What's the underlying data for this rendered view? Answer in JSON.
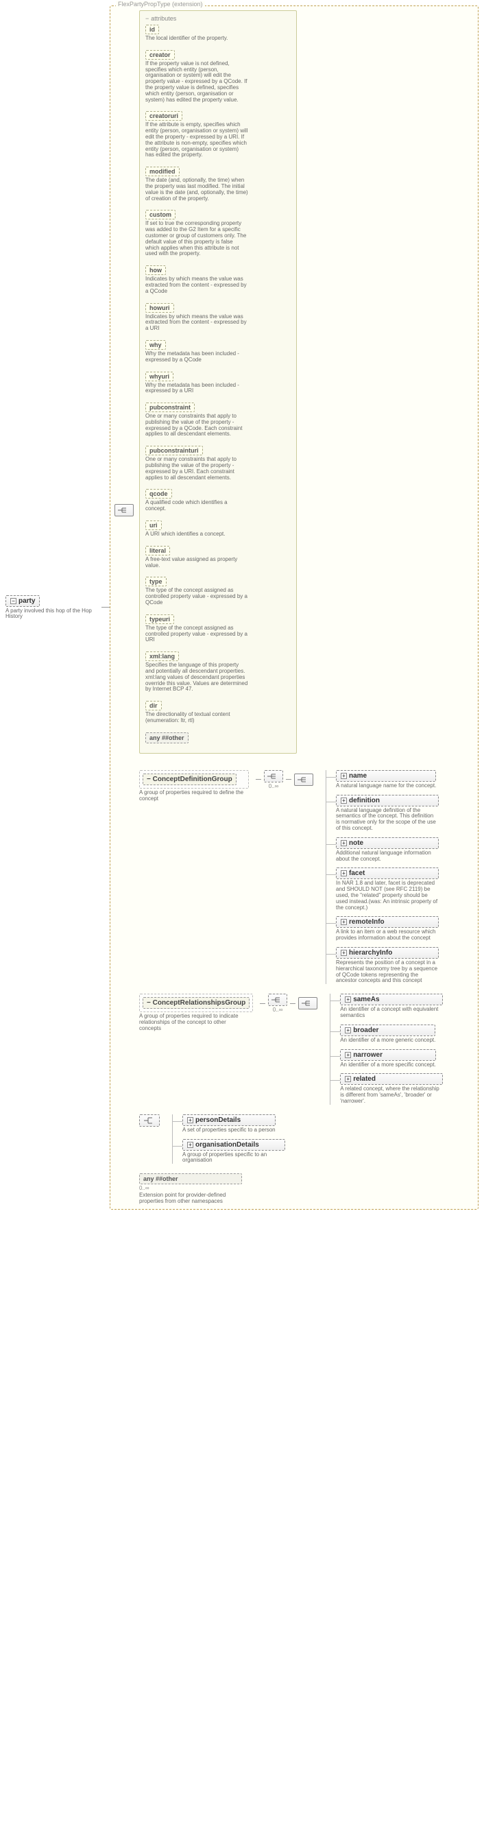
{
  "root": {
    "name": "party",
    "desc": "A party involved this hop of the Hop History"
  },
  "extension": {
    "label": "FlexPartyPropType (extension)"
  },
  "attrs_label": "attributes",
  "attributes": [
    {
      "name": "id",
      "desc": "The local identifier of the property."
    },
    {
      "name": "creator",
      "desc": "If the property value is not defined, specifies which entity (person, organisation or system) will edit the property value - expressed by a QCode. If the property value is defined, specifies which entity (person, organisation or system) has edited the property value."
    },
    {
      "name": "creatoruri",
      "desc": "If the attribute is empty, specifies which entity (person, organisation or system) will edit the property - expressed by a URI. If the attribute is non-empty, specifies which entity (person, organisation or system) has edited the property."
    },
    {
      "name": "modified",
      "desc": "The date (and, optionally, the time) when the property was last modified. The initial value is the date (and, optionally, the time) of creation of the property."
    },
    {
      "name": "custom",
      "desc": "If set to true the corresponding property was added to the G2 Item for a specific customer or group of customers only. The default value of this property is false which applies when this attribute is not used with the property."
    },
    {
      "name": "how",
      "desc": "Indicates by which means the value was extracted from the content - expressed by a QCode"
    },
    {
      "name": "howuri",
      "desc": "Indicates by which means the value was extracted from the content - expressed by a URI"
    },
    {
      "name": "why",
      "desc": "Why the metadata has been included - expressed by a QCode"
    },
    {
      "name": "whyuri",
      "desc": "Why the metadata has been included - expressed by a URI"
    },
    {
      "name": "pubconstraint",
      "desc": "One or many constraints that apply to publishing the value of the property - expressed by a QCode. Each constraint applies to all descendant elements."
    },
    {
      "name": "pubconstrainturi",
      "desc": "One or many constraints that apply to publishing the value of the property - expressed by a URI. Each constraint applies to all descendant elements."
    },
    {
      "name": "qcode",
      "desc": "A qualified code which identifies a concept."
    },
    {
      "name": "uri",
      "desc": "A URI which identifies a concept."
    },
    {
      "name": "literal",
      "desc": "A free-text value assigned as property value."
    },
    {
      "name": "type",
      "desc": "The type of the concept assigned as controlled property value - expressed by a QCode"
    },
    {
      "name": "typeuri",
      "desc": "The type of the concept assigned as controlled property value - expressed by a URI"
    },
    {
      "name": "xml:lang",
      "desc": "Specifies the language of this property and potentially all descendant properties. xml:lang values of descendant properties override this value. Values are determined by Internet BCP 47."
    },
    {
      "name": "dir",
      "desc": "The directionality of textual content (enumeration: ltr, rtl)"
    }
  ],
  "attrs_any": "any ##other",
  "sequence_marker": "…",
  "groups": {
    "concept_def": {
      "title": "ConceptDefinitionGroup",
      "desc": "A group of properties required to define the concept",
      "occurs": "0..∞",
      "children": [
        {
          "name": "name",
          "desc": "A natural language name for the concept."
        },
        {
          "name": "definition",
          "desc": "A natural language definition of the semantics of the concept. This definition is normative only for the scope of the use of this concept."
        },
        {
          "name": "note",
          "desc": "Additional natural language information about the concept."
        },
        {
          "name": "facet",
          "desc": "In NAR 1.8 and later, facet is deprecated and SHOULD NOT (see RFC 2119) be used, the \"related\" property should be used instead.(was: An intrinsic property of the concept.)"
        },
        {
          "name": "remoteInfo",
          "desc": "A link to an item or a web resource which provides information about the concept"
        },
        {
          "name": "hierarchyInfo",
          "desc": "Represents the position of a concept in a hierarchical taxonomy tree by a sequence of QCode tokens representing the ancestor concepts and this concept"
        }
      ]
    },
    "concept_rel": {
      "title": "ConceptRelationshipsGroup",
      "desc": "A group of properties required to indicate relationships of the concept to other concepts",
      "occurs": "0..∞",
      "children": [
        {
          "name": "sameAs",
          "desc": "An identifier of a concept with equivalent semantics"
        },
        {
          "name": "broader",
          "desc": "An identifier of a more generic concept."
        },
        {
          "name": "narrower",
          "desc": "An identifier of a more specific concept."
        },
        {
          "name": "related",
          "desc": "A related concept, where the relationship is different from 'sameAs', 'broader' or 'narrower'."
        }
      ]
    },
    "details": {
      "children": [
        {
          "name": "personDetails",
          "desc": "A set of properties specific to a person"
        },
        {
          "name": "organisationDetails",
          "desc": "A group of properties specific to an organisation"
        }
      ]
    }
  },
  "bottom_any": {
    "label": "any ##other",
    "occurs": "0..∞",
    "desc": "Extension point for provider-defined properties from other namespaces"
  }
}
